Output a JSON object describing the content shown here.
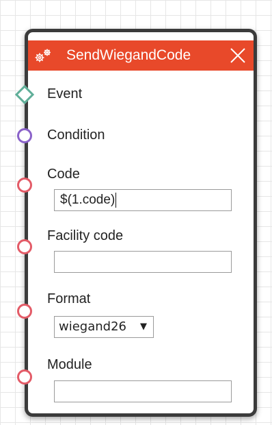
{
  "node": {
    "title": "SendWiegandCode",
    "icon": "gears-icon",
    "close_icon": "close-icon",
    "header_color": "#e8492a"
  },
  "ports": {
    "event": {
      "label": "Event",
      "shape": "diamond",
      "color": "#5fae98"
    },
    "condition": {
      "label": "Condition",
      "shape": "circle",
      "color": "#8a62c9"
    }
  },
  "params": {
    "code": {
      "label": "Code",
      "value": "$(1.code)",
      "port_color": "#e35b67"
    },
    "facility_code": {
      "label": "Facility code",
      "value": "",
      "port_color": "#e35b67"
    },
    "format": {
      "label": "Format",
      "selected": "wiegand26",
      "port_color": "#e35b67"
    },
    "module": {
      "label": "Module",
      "value": "",
      "port_color": "#e35b67"
    }
  }
}
